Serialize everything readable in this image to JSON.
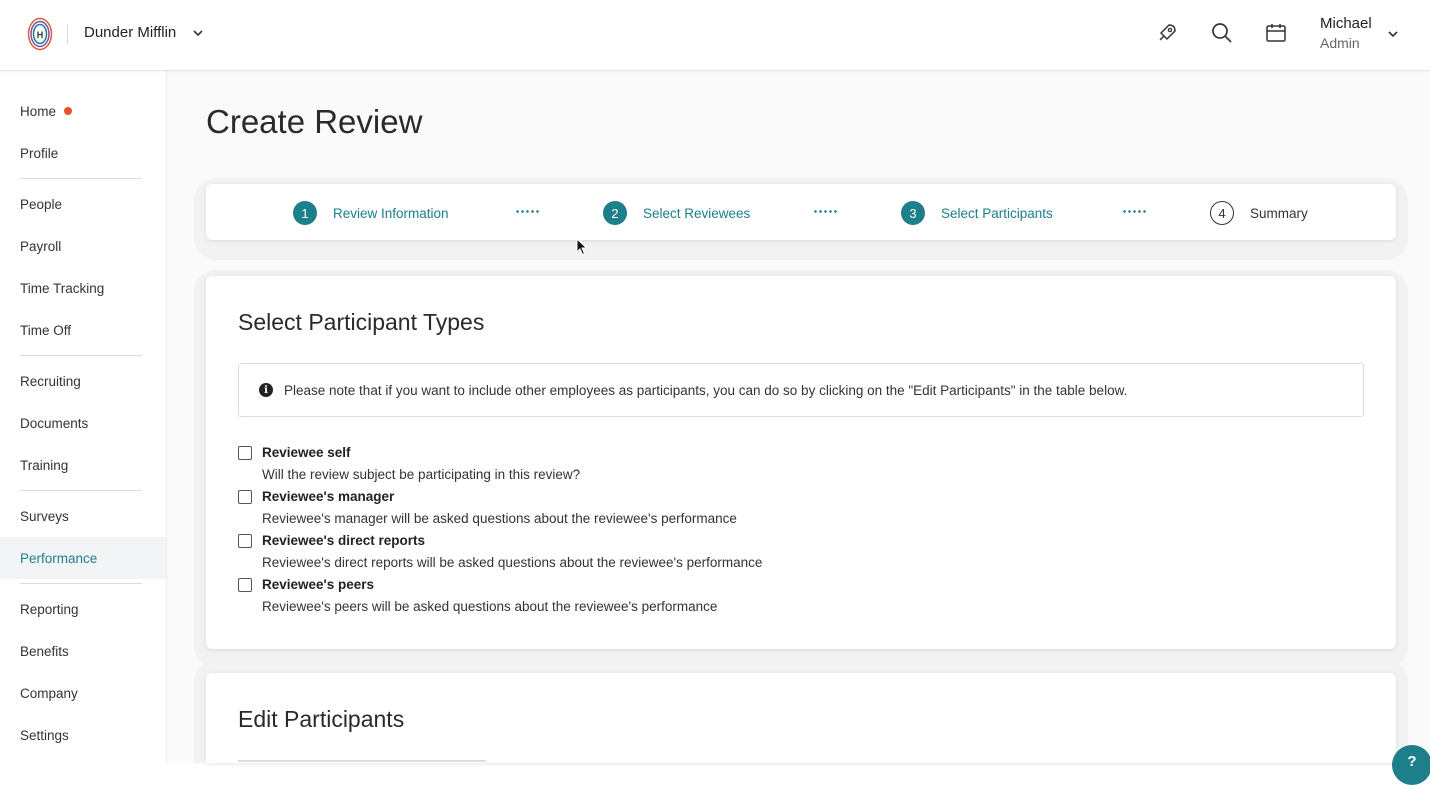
{
  "header": {
    "company_name": "Dunder Mifflin",
    "user_name": "Michael",
    "user_role": "Admin",
    "icons": [
      "logo-icon",
      "rocket-icon",
      "search-icon",
      "calendar-icon"
    ]
  },
  "sidebar": {
    "items": [
      {
        "label": "Home"
      },
      {
        "label": "Profile"
      },
      {
        "label": "People"
      },
      {
        "label": "Payroll"
      },
      {
        "label": "Time Tracking"
      },
      {
        "label": "Time Off"
      },
      {
        "label": "Recruiting"
      },
      {
        "label": "Documents"
      },
      {
        "label": "Training"
      },
      {
        "label": "Surveys"
      },
      {
        "label": "Performance"
      },
      {
        "label": "Reporting"
      },
      {
        "label": "Benefits"
      },
      {
        "label": "Company"
      },
      {
        "label": "Settings"
      }
    ],
    "active": "Performance"
  },
  "page": {
    "title": "Create Review"
  },
  "stepper": {
    "steps": [
      {
        "number": "1",
        "label": "Review Information",
        "status": "complete"
      },
      {
        "number": "2",
        "label": "Select Reviewees",
        "status": "complete"
      },
      {
        "number": "3",
        "label": "Select Participants",
        "status": "current"
      },
      {
        "number": "4",
        "label": "Summary",
        "status": "pending"
      }
    ]
  },
  "participant_types": {
    "title": "Select Participant Types",
    "info": "Please note that if you want to include other employees as participants, you can do so by clicking on the \"Edit Participants\" in the table below.",
    "options": [
      {
        "title": "Reviewee self",
        "description": "Will the review subject be participating in this review?",
        "checked": false
      },
      {
        "title": "Reviewee's manager",
        "description": "Reviewee's manager will be asked questions about the reviewee's performance",
        "checked": false
      },
      {
        "title": "Reviewee's direct reports",
        "description": "Reviewee's direct reports will be asked questions about the reviewee's performance",
        "checked": false
      },
      {
        "title": "Reviewee's peers",
        "description": "Reviewee's peers will be asked questions about the reviewee's performance",
        "checked": false
      }
    ]
  },
  "edit_participants": {
    "title": "Edit Participants"
  },
  "help": {
    "label": "?"
  },
  "colors": {
    "accent": "#1c7f8a",
    "notification_dot": "#e5532d"
  }
}
